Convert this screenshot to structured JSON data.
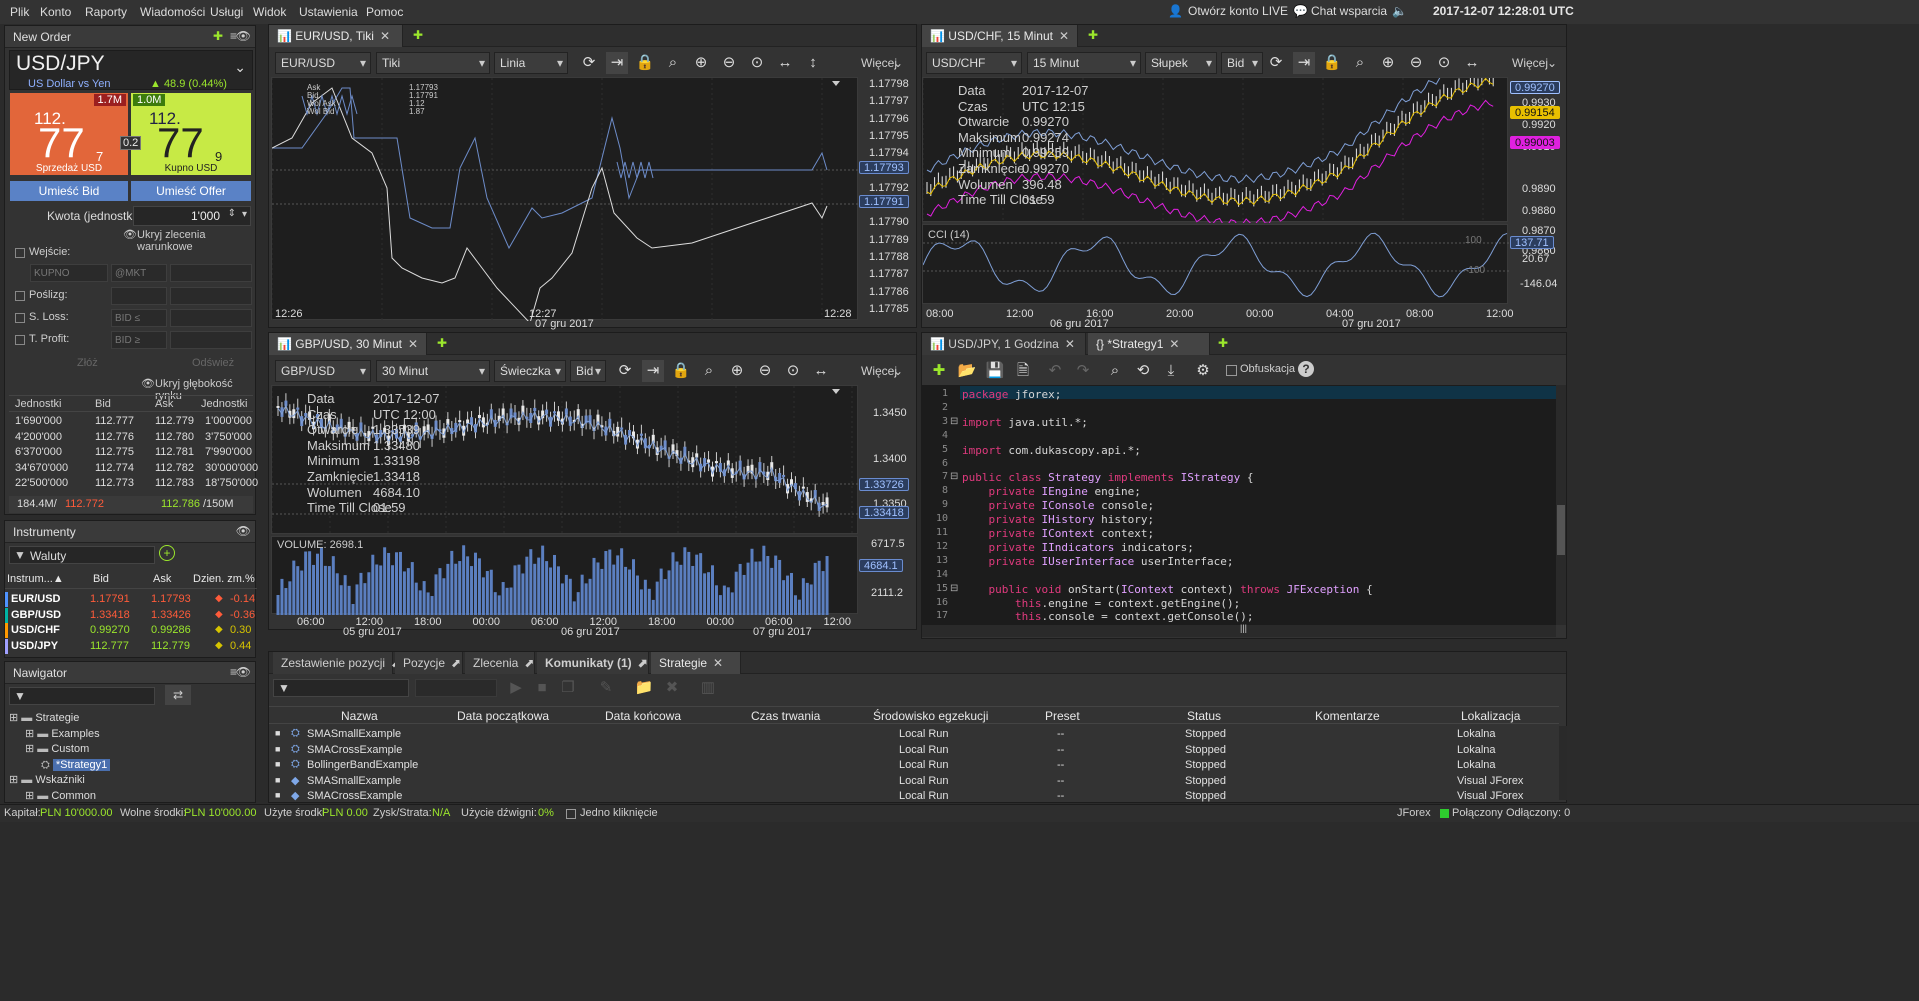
{
  "menu": [
    "Plik",
    "Konto",
    "Raporty",
    "Wiadomości",
    "Usługi",
    "Widok",
    "Ustawienia",
    "Pomoc"
  ],
  "topright": {
    "open_live": "Otwórz konto LIVE",
    "chat": "Chat wsparcia",
    "datetime": "2017-12-07 12:28:01 UTC"
  },
  "new_order": {
    "title": "New Order",
    "symbol": "USD/JPY",
    "desc": "US Dollar vs Yen",
    "change": "▲ 48.9 (0.44%)",
    "sell": {
      "vol": "1.7M",
      "big": "112.",
      "pips": "77",
      "frac": "7",
      "label": "Sprzedaż USD"
    },
    "buy": {
      "vol": "1.0M",
      "big": "112.",
      "pips": "77",
      "frac": "9",
      "label": "Kupno USD"
    },
    "spread": "0.2",
    "place_bid": "Umieść Bid",
    "place_offer": "Umieść Offer",
    "amount_label": "Kwota (jednostki):",
    "amount_value": "1'000",
    "hide_cond": "Ukryj zlecenia warunkowe",
    "entry": "Wejście:",
    "entry_side": "KUPNO",
    "entry_mkt": "@MKT",
    "slip": "Poślizg:",
    "sl": "S. Loss:",
    "sl_ph": "BID ≤",
    "tp": "T. Profit:",
    "tp_ph": "BID ≥",
    "submit": "Złóż",
    "refresh": "Odśwież",
    "hide_depth": "Ukryj głębokość rynku",
    "depth_headers": [
      "Jednostki",
      "Bid",
      "Ask",
      "Jednostki"
    ],
    "depth": [
      [
        "1'690'000",
        "112.777",
        "112.779",
        "1'000'000"
      ],
      [
        "4'200'000",
        "112.776",
        "112.780",
        "3'750'000"
      ],
      [
        "6'370'000",
        "112.775",
        "112.781",
        "7'990'000"
      ],
      [
        "34'670'000",
        "112.774",
        "112.782",
        "30'000'000"
      ],
      [
        "22'500'000",
        "112.773",
        "112.783",
        "18'750'000"
      ]
    ],
    "totals": {
      "bidvol": "184.4M/",
      "bid": "112.772",
      "ask": "112.786",
      "askvol": "/150M"
    }
  },
  "instruments": {
    "title": "Instrumenty",
    "filter": "Waluty",
    "headers": [
      "Instrum...▲",
      "Bid",
      "Ask",
      "Dzien. zm.%"
    ],
    "rows": [
      {
        "sym": "EUR/USD",
        "bid": "1.17791",
        "ask": "1.17793",
        "chg": "-0.14",
        "dir": "down"
      },
      {
        "sym": "GBP/USD",
        "bid": "1.33418",
        "ask": "1.33426",
        "chg": "-0.36",
        "dir": "down"
      },
      {
        "sym": "USD/CHF",
        "bid": "0.99270",
        "ask": "0.99286",
        "chg": "0.30",
        "dir": "up"
      },
      {
        "sym": "USD/JPY",
        "bid": "112.777",
        "ask": "112.779",
        "chg": "0.44",
        "dir": "up"
      }
    ]
  },
  "navigator": {
    "title": "Nawigator",
    "items": [
      {
        "label": "Strategie",
        "lvl": 0
      },
      {
        "label": "Examples",
        "lvl": 1
      },
      {
        "label": "Custom",
        "lvl": 1
      },
      {
        "label": "*Strategy1",
        "lvl": 2
      },
      {
        "label": "Wskaźniki",
        "lvl": 0
      },
      {
        "label": "Common",
        "lvl": 1
      }
    ]
  },
  "chart1": {
    "tab": "EUR/USD, Tiki",
    "sym": "EUR/USD",
    "period": "Tiki",
    "style": "Linia",
    "more": "Więcej",
    "prices": [
      "1.17798",
      "1.17797",
      "1.17796",
      "1.17795",
      "1.17794",
      "1.17793",
      "1.17792",
      "1.17791",
      "1.17790",
      "1.17789",
      "1.17788",
      "1.17787",
      "1.17786",
      "1.17785"
    ],
    "tag_ask": "1.17793",
    "tag_bid": "1.17791",
    "legend": [
      [
        "Ask",
        "1.17793"
      ],
      [
        "Bid",
        "1.17791"
      ],
      [
        "Wol Ask",
        "1.12"
      ],
      [
        "Wol Bid",
        "1.87"
      ]
    ],
    "times": [
      "12:26",
      "12:27",
      "12:28"
    ],
    "date": "07 gru 2017"
  },
  "chart2": {
    "tab": "USD/CHF, 15 Minut",
    "sym": "USD/CHF",
    "period": "15 Minut",
    "style": "Słupek",
    "side": "Bid",
    "more": "Więcej",
    "prices": [
      "0.9930",
      "0.9920",
      "0.9910",
      "0.9890",
      "0.9880",
      "0.9870",
      "0.9860"
    ],
    "tags": [
      "0.99270",
      "0.99154",
      "0.99003"
    ],
    "info": [
      [
        "Data",
        "2017-12-07"
      ],
      [
        "Czas",
        "UTC 12:15"
      ],
      [
        "Otwarcie",
        "0.99270"
      ],
      [
        "Maksimum",
        "0.99274"
      ],
      [
        "Minimum",
        "0.99259"
      ],
      [
        "Zamknięcie",
        "0.99270"
      ],
      [
        "Wolumen",
        "396.48"
      ],
      [
        "Time Till Close",
        "01:59"
      ]
    ],
    "cci": "CCI (14)",
    "cci_vals": [
      "137.71",
      "20.67",
      "-146.04"
    ],
    "cci_levels": [
      "100",
      "-100"
    ],
    "times": [
      "08:00",
      "12:00",
      "16:00",
      "20:00",
      "00:00",
      "04:00",
      "08:00",
      "12:00"
    ],
    "dates": [
      "06 gru 2017",
      "07 gru 2017"
    ]
  },
  "chart3": {
    "tab": "GBP/USD, 30 Minut",
    "sym": "GBP/USD",
    "period": "30 Minut",
    "style": "Świeczka",
    "side": "Bid",
    "more": "Więcej",
    "prices": [
      "1.3450",
      "1.3400",
      "1.3350"
    ],
    "tag": "1.33726",
    "tag2": "1.33418",
    "info": [
      [
        "Data",
        "2017-12-07"
      ],
      [
        "Czas",
        "UTC 12:00"
      ],
      [
        "Otwarcie",
        "1.33539"
      ],
      [
        "Maksimum",
        "1.33480"
      ],
      [
        "Minimum",
        "1.33198"
      ],
      [
        "Zamknięcie",
        "1.33418"
      ],
      [
        "Wolumen",
        "4684.10"
      ],
      [
        "Time Till Close",
        "01:59"
      ]
    ],
    "volume_label": "VOLUME: 2698.1",
    "vol_axis": [
      "6717.5",
      "4684.1",
      "2111.2"
    ],
    "times": [
      "06:00",
      "12:00",
      "18:00",
      "00:00",
      "06:00",
      "12:00",
      "18:00",
      "00:00",
      "06:00",
      "12:00"
    ],
    "dates": [
      "05 gru 2017",
      "06 gru 2017",
      "07 gru 2017"
    ]
  },
  "editor": {
    "tab1": "USD/JPY, 1 Godzina",
    "tab2": "*Strategy1",
    "obf": "Obfuskacja",
    "lines": [
      [
        {
          "t": "package jforex;",
          "c": "kw"
        }
      ],
      [],
      [
        {
          "t": "import java.util.*;",
          "c": "kw"
        }
      ],
      [],
      [
        {
          "t": "import com.dukascopy.api.*;",
          "c": "kw"
        }
      ],
      [],
      [
        {
          "t": "public class Strategy implements IStrategy {",
          "c": "kw"
        }
      ],
      [
        {
          "t": "    private IEngine engine;",
          "c": "kw"
        }
      ],
      [
        {
          "t": "    private IConsole console;",
          "c": "kw"
        }
      ],
      [
        {
          "t": "    private IHistory history;",
          "c": "kw"
        }
      ],
      [
        {
          "t": "    private IContext context;",
          "c": "kw"
        }
      ],
      [
        {
          "t": "    private IIndicators indicators;",
          "c": "kw"
        }
      ],
      [
        {
          "t": "    private IUserInterface userInterface;",
          "c": "kw"
        }
      ],
      [],
      [
        {
          "t": "    public void onStart(IContext context) throws JFException {",
          "c": "kw"
        }
      ],
      [
        {
          "t": "        this.engine = context.getEngine();",
          "c": "kw"
        }
      ],
      [
        {
          "t": "        this.console = context.getConsole();",
          "c": "kw"
        }
      ]
    ]
  },
  "bottom": {
    "tabs": [
      "Zestawienie pozycji",
      "Pozycje",
      "Zlecenia",
      "Komunikaty (1)",
      "Strategie"
    ],
    "headers": [
      "Nazwa",
      "Data początkowa",
      "Data końcowa",
      "Czas trwania",
      "Środowisko egzekucji",
      "Preset",
      "Status",
      "Komentarze",
      "Lokalizacja"
    ],
    "rows": [
      [
        "SMASmallExample",
        "",
        "",
        "",
        "Local Run",
        "--",
        "Stopped",
        "",
        "Lokalna"
      ],
      [
        "SMACrossExample",
        "",
        "",
        "",
        "Local Run",
        "--",
        "Stopped",
        "",
        "Lokalna"
      ],
      [
        "BollingerBandExample",
        "",
        "",
        "",
        "Local Run",
        "--",
        "Stopped",
        "",
        "Lokalna"
      ],
      [
        "SMASmallExample",
        "",
        "",
        "",
        "Local Run",
        "--",
        "Stopped",
        "",
        "Visual JForex"
      ],
      [
        "SMACrossExample",
        "",
        "",
        "",
        "Local Run",
        "--",
        "Stopped",
        "",
        "Visual JForex"
      ]
    ]
  },
  "status": {
    "capital_label": "Kapitał:",
    "capital": "PLN 10'000.00",
    "free_label": "Wolne środki:",
    "free": "PLN 10'000.00",
    "used_label": "Użyte środki",
    "used": "PLN 0.00",
    "pl_label": "Zysk/Strata:",
    "pl": "N/A",
    "lev_label": "Użycie dźwigni:",
    "lev": "0%",
    "one_click": "Jedno kliknięcie",
    "app": "JForex",
    "conn": "Połączony",
    "disc": "Odłączony: 0"
  }
}
